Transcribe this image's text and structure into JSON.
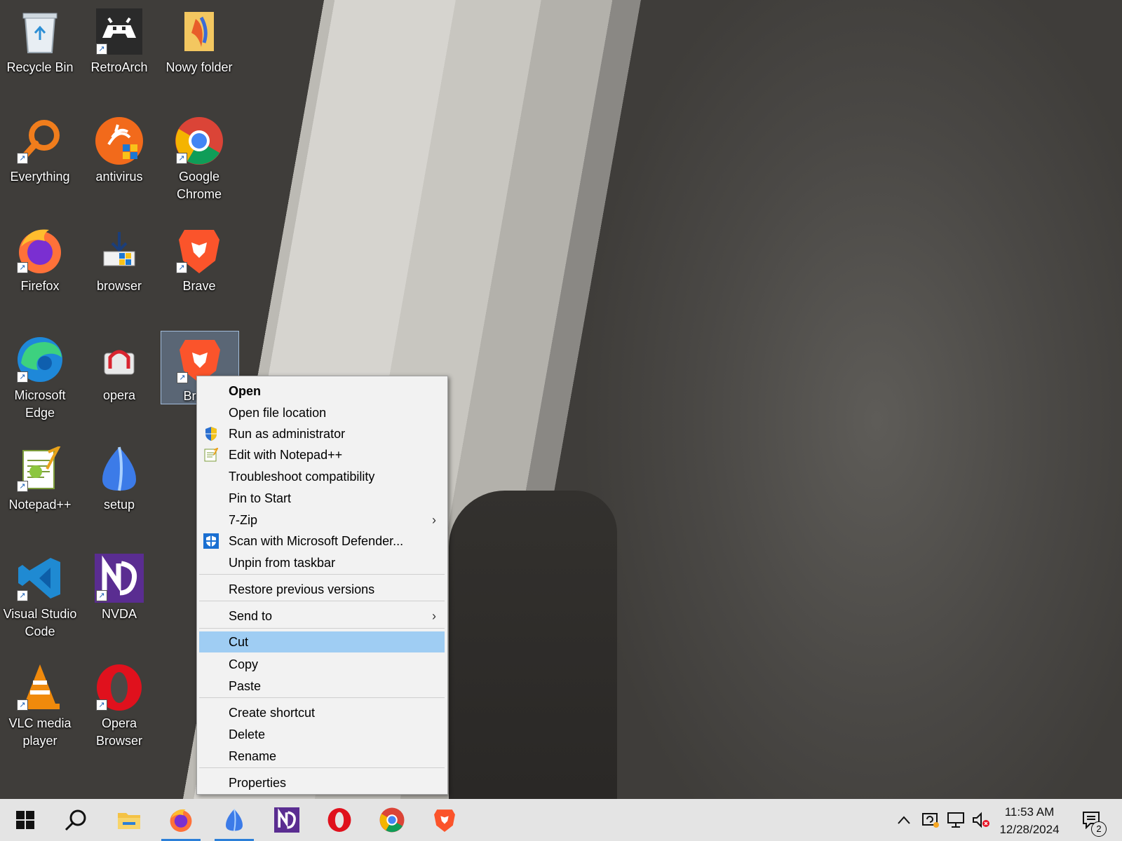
{
  "desktop": {
    "icons": [
      {
        "label": "Recycle Bin"
      },
      {
        "label": "RetroArch"
      },
      {
        "label": "Nowy folder"
      },
      {
        "label": "Everything"
      },
      {
        "label": "antivirus"
      },
      {
        "label": "Google Chrome"
      },
      {
        "label": "Firefox"
      },
      {
        "label": "browser"
      },
      {
        "label": "Brave"
      },
      {
        "label": "Microsoft Edge"
      },
      {
        "label": "opera"
      },
      {
        "label": "Brave"
      },
      {
        "label": "Notepad++"
      },
      {
        "label": "setup"
      },
      {
        "label": "Visual Studio Code"
      },
      {
        "label": "NVDA"
      },
      {
        "label": "VLC media player"
      },
      {
        "label": "Opera Browser"
      }
    ]
  },
  "context_menu": {
    "items": [
      {
        "label": "Open"
      },
      {
        "label": "Open file location"
      },
      {
        "label": "Run as administrator",
        "icon": "shield-icon"
      },
      {
        "label": "Edit with Notepad++",
        "icon": "notepad-icon"
      },
      {
        "label": "Troubleshoot compatibility"
      },
      {
        "label": "Pin to Start"
      },
      {
        "label": "7-Zip",
        "submenu": true
      },
      {
        "label": "Scan with Microsoft Defender...",
        "icon": "defender-icon"
      },
      {
        "label": "Unpin from taskbar"
      },
      {
        "label": "Restore previous versions"
      },
      {
        "label": "Send to",
        "submenu": true
      },
      {
        "label": "Cut"
      },
      {
        "label": "Copy"
      },
      {
        "label": "Paste"
      },
      {
        "label": "Create shortcut"
      },
      {
        "label": "Delete"
      },
      {
        "label": "Rename"
      },
      {
        "label": "Properties"
      }
    ],
    "highlighted": "Cut",
    "submenu_arrow": "›"
  },
  "taskbar": {
    "apps": [
      "start-icon",
      "search-icon",
      "file-explorer-icon",
      "firefox-icon",
      "setup-icon",
      "nvda-icon",
      "opera-icon",
      "chrome-icon",
      "brave-icon"
    ],
    "clock": {
      "time": "11:53 AM",
      "date": "12/28/2024"
    },
    "notification_count": "2"
  },
  "colors": {
    "menu_highlight": "#9fcdf3",
    "accent": "#2b7fd8"
  }
}
